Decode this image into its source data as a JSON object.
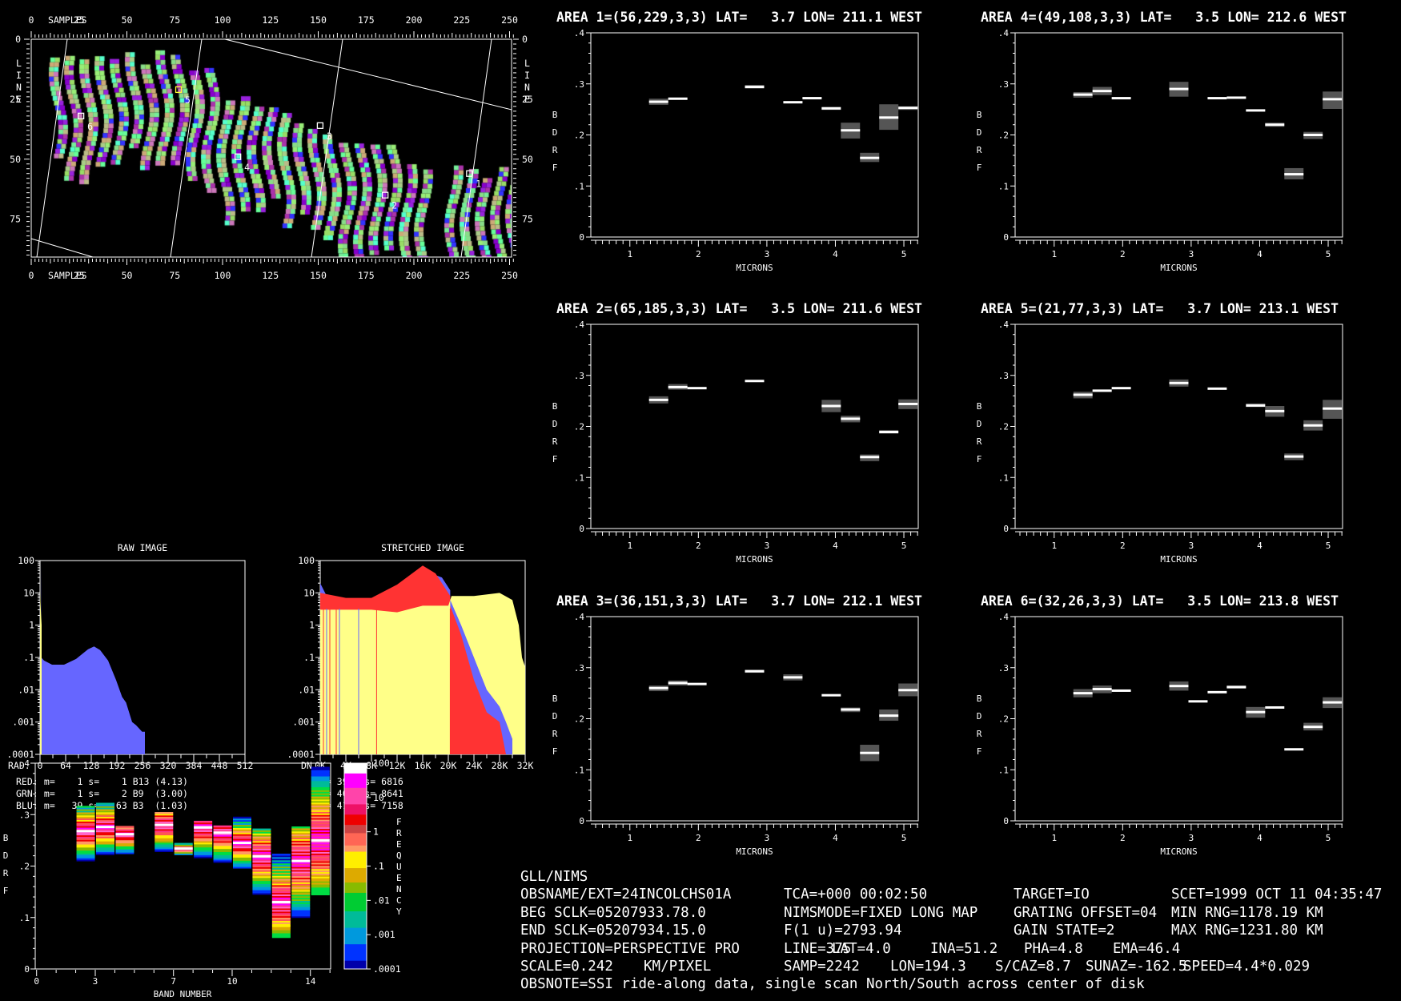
{
  "map": {
    "x_label": "SAMPLES",
    "y_label_letters": [
      "L",
      "I",
      "N",
      "E"
    ],
    "x_ticks": [
      0,
      25,
      50,
      75,
      100,
      125,
      150,
      175,
      200,
      225,
      250
    ],
    "y_ticks": [
      0,
      25,
      50,
      75
    ],
    "areas": [
      {
        "id": "1",
        "line": 56,
        "sample": 229,
        "color": "#ffffff"
      },
      {
        "id": "2",
        "line": 65,
        "sample": 185,
        "color": "#ffffff"
      },
      {
        "id": "3",
        "line": 36,
        "sample": 151,
        "color": "#ffffff"
      },
      {
        "id": "4",
        "line": 49,
        "sample": 108,
        "color": "#ffffff"
      },
      {
        "id": "5",
        "line": 21,
        "sample": 77,
        "color": "#ffff33"
      },
      {
        "id": "6",
        "line": 32,
        "sample": 26,
        "color": "#ffffff"
      }
    ]
  },
  "histograms": {
    "y_ticks": [
      "100",
      "10",
      "1",
      ".1",
      ".01",
      ".001",
      ".0001"
    ],
    "raw": {
      "title": "RAW IMAGE",
      "axis_label": "RAD.",
      "xlim": [
        0,
        512
      ],
      "x_ticks": [
        "0",
        "64",
        "128",
        "192",
        "256",
        "320",
        "384",
        "448",
        "512"
      ],
      "series": [
        {
          "name": "blue",
          "color": "#6666ff",
          "points": [
            [
              0,
              0.0001
            ],
            [
              2,
              0.0001
            ],
            [
              2,
              100
            ],
            [
              3,
              0.1
            ],
            [
              10,
              0.08
            ],
            [
              30,
              0.06
            ],
            [
              60,
              0.06
            ],
            [
              90,
              0.09
            ],
            [
              120,
              0.18
            ],
            [
              135,
              0.22
            ],
            [
              150,
              0.17
            ],
            [
              170,
              0.08
            ],
            [
              190,
              0.02
            ],
            [
              205,
              0.006
            ],
            [
              215,
              0.004
            ],
            [
              230,
              0.001
            ],
            [
              240,
              0.0008
            ],
            [
              255,
              0.0005
            ],
            [
              262,
              0.0005
            ],
            [
              262,
              0.0001
            ]
          ]
        },
        {
          "name": "yellow",
          "color": "#ffff88",
          "points": [
            [
              0,
              0.0001
            ],
            [
              0,
              10
            ],
            [
              2,
              3
            ],
            [
              4,
              1
            ],
            [
              4,
              0.0001
            ]
          ]
        }
      ]
    },
    "stretched": {
      "title": "STRETCHED IMAGE",
      "axis_label": "DN",
      "xlim": [
        0,
        32
      ],
      "x_ticks": [
        "0K",
        "4K",
        "8K",
        "12K",
        "16K",
        "20K",
        "24K",
        "28K",
        "32K"
      ],
      "series": [
        {
          "name": "blue-low",
          "color": "#6666ff",
          "points": [
            [
              0,
              0.0001
            ],
            [
              0,
              20
            ],
            [
              1,
              8
            ],
            [
              4,
              6
            ],
            [
              8,
              6
            ],
            [
              12,
              12
            ],
            [
              16,
              50
            ],
            [
              19,
              30
            ],
            [
              20.3,
              12
            ],
            [
              20.3,
              0.0001
            ]
          ]
        },
        {
          "name": "red-low",
          "color": "#ff3333",
          "points": [
            [
              0,
              0.0001
            ],
            [
              0,
              10
            ],
            [
              4,
              7
            ],
            [
              8,
              7
            ],
            [
              12,
              18
            ],
            [
              16,
              70
            ],
            [
              18,
              40
            ],
            [
              20.3,
              8
            ],
            [
              20.3,
              0.0001
            ]
          ]
        },
        {
          "name": "yellow",
          "color": "#ffff88",
          "points": [
            [
              0,
              0.0001
            ],
            [
              0,
              3
            ],
            [
              4,
              3
            ],
            [
              8,
              3
            ],
            [
              12,
              2.5
            ],
            [
              16,
              4
            ],
            [
              20,
              4
            ],
            [
              20.5,
              8
            ],
            [
              24,
              8
            ],
            [
              28,
              10
            ],
            [
              30,
              6
            ],
            [
              31,
              1
            ],
            [
              31.5,
              0.1
            ],
            [
              32,
              0.05
            ],
            [
              32,
              0.0001
            ]
          ]
        },
        {
          "name": "blue-high",
          "color": "#6666ff",
          "points": [
            [
              20.3,
              0.0001
            ],
            [
              20.3,
              6
            ],
            [
              22,
              1
            ],
            [
              24,
              0.1
            ],
            [
              26,
              0.01
            ],
            [
              28,
              0.003
            ],
            [
              29,
              0.001
            ],
            [
              30,
              0.0003
            ],
            [
              30,
              0.0001
            ]
          ]
        },
        {
          "name": "red-high",
          "color": "#ff3333",
          "points": [
            [
              20.3,
              0.0001
            ],
            [
              20.3,
              4
            ],
            [
              22,
              0.5
            ],
            [
              24,
              0.02
            ],
            [
              26,
              0.002
            ],
            [
              28,
              0.001
            ],
            [
              29,
              0.0001
            ]
          ]
        }
      ]
    },
    "stats": [
      {
        "label": "RED:",
        "text": " m=    1 s=    1 B13 (4.13)",
        "color": "#ff3333"
      },
      {
        "label": "GRN:",
        "text": " m=    1 s=    2 B9  (3.00)",
        "color": "#ffff88"
      },
      {
        "label": "BLU:",
        "text": " m=   39 s=   63 B3  (1.03)",
        "color": "#6666ff"
      }
    ],
    "stretched_stats": [
      "m= 3944 s= 6816",
      "m= 4026 s= 8641",
      "m= 4129 s= 7158"
    ]
  },
  "chart_data": [
    {
      "type": "bar",
      "title": "AREA 1=(56,229,3,3) LAT=   3.7 LON= 211.1 WEST",
      "xlabel": "MICRONS",
      "ylabel": "BDRF",
      "xlim": [
        0.43,
        5.21
      ],
      "ylim": [
        0,
        0.4
      ],
      "x_ticks": [
        "1",
        "2",
        "3",
        "4",
        "5"
      ],
      "y_ticks": [
        "0",
        ".1",
        ".2",
        ".3",
        ".4"
      ],
      "bands": [
        [
          0,
          0.265,
          0.259,
          0.271
        ],
        [
          1,
          0.271,
          0.269,
          0.273
        ],
        [
          5,
          0.294,
          0.291,
          0.298
        ],
        [
          7,
          0.264,
          0.263,
          0.266
        ],
        [
          8,
          0.272,
          0.271,
          0.274
        ],
        [
          9,
          0.252,
          0.249,
          0.255
        ],
        [
          10,
          0.209,
          0.193,
          0.224
        ],
        [
          11,
          0.155,
          0.147,
          0.165
        ],
        [
          12,
          0.234,
          0.21,
          0.26
        ],
        [
          13,
          0.253,
          0.249,
          0.256
        ]
      ]
    },
    {
      "type": "bar",
      "title": "AREA 4=(49,108,3,3) LAT=   3.5 LON= 212.6 WEST",
      "xlabel": "MICRONS",
      "ylabel": "BDRF",
      "xlim": [
        0.43,
        5.21
      ],
      "ylim": [
        0,
        0.4
      ],
      "x_ticks": [
        "1",
        "2",
        "3",
        "4",
        "5"
      ],
      "y_ticks": [
        "0",
        ".1",
        ".2",
        ".3",
        ".4"
      ],
      "bands": [
        [
          0,
          0.279,
          0.273,
          0.284
        ],
        [
          1,
          0.286,
          0.278,
          0.294
        ],
        [
          2,
          0.272,
          0.271,
          0.273
        ],
        [
          5,
          0.29,
          0.275,
          0.304
        ],
        [
          7,
          0.272,
          0.271,
          0.273
        ],
        [
          8,
          0.273,
          0.272,
          0.275
        ],
        [
          9,
          0.248,
          0.246,
          0.25
        ],
        [
          10,
          0.22,
          0.216,
          0.224
        ],
        [
          11,
          0.123,
          0.113,
          0.135
        ],
        [
          12,
          0.2,
          0.192,
          0.206
        ],
        [
          13,
          0.27,
          0.251,
          0.285
        ]
      ]
    },
    {
      "type": "bar",
      "title": "AREA 2=(65,185,3,3) LAT=   3.5 LON= 211.6 WEST",
      "xlabel": "MICRONS",
      "ylabel": "BDRF",
      "xlim": [
        0.43,
        5.21
      ],
      "ylim": [
        0,
        0.4
      ],
      "x_ticks": [
        "1",
        "2",
        "3",
        "4",
        "5"
      ],
      "y_ticks": [
        "0",
        ".1",
        ".2",
        ".3",
        ".4"
      ],
      "bands": [
        [
          0,
          0.252,
          0.245,
          0.259
        ],
        [
          1,
          0.277,
          0.272,
          0.283
        ],
        [
          2,
          0.275,
          0.274,
          0.276
        ],
        [
          5,
          0.289,
          0.288,
          0.29
        ],
        [
          9,
          0.24,
          0.228,
          0.252
        ],
        [
          10,
          0.215,
          0.208,
          0.221
        ],
        [
          11,
          0.14,
          0.132,
          0.145
        ],
        [
          12,
          0.189,
          0.186,
          0.193
        ],
        [
          13,
          0.244,
          0.234,
          0.253
        ]
      ]
    },
    {
      "type": "bar",
      "title": "AREA 5=(21,77,3,3) LAT=   3.7 LON= 213.1 WEST",
      "xlabel": "MICRONS",
      "ylabel": "BDRF",
      "xlim": [
        0.43,
        5.21
      ],
      "ylim": [
        0,
        0.4
      ],
      "x_ticks": [
        "1",
        "2",
        "3",
        "4",
        "5"
      ],
      "y_ticks": [
        "0",
        ".1",
        ".2",
        ".3",
        ".4"
      ],
      "bands": [
        [
          0,
          0.262,
          0.255,
          0.268
        ],
        [
          1,
          0.27,
          0.268,
          0.272
        ],
        [
          2,
          0.275,
          0.274,
          0.276
        ],
        [
          5,
          0.285,
          0.278,
          0.292
        ],
        [
          7,
          0.274,
          0.273,
          0.275
        ],
        [
          9,
          0.241,
          0.238,
          0.245
        ],
        [
          10,
          0.23,
          0.219,
          0.24
        ],
        [
          11,
          0.141,
          0.134,
          0.147
        ],
        [
          12,
          0.202,
          0.192,
          0.212
        ],
        [
          13,
          0.235,
          0.215,
          0.252
        ]
      ]
    },
    {
      "type": "bar",
      "title": "AREA 3=(36,151,3,3) LAT=   3.7 LON= 212.1 WEST",
      "xlabel": "MICRONS",
      "ylabel": "BDRF",
      "xlim": [
        0.43,
        5.21
      ],
      "ylim": [
        0,
        0.4
      ],
      "x_ticks": [
        "1",
        "2",
        "3",
        "4",
        "5"
      ],
      "y_ticks": [
        "0",
        ".1",
        ".2",
        ".3",
        ".4"
      ],
      "bands": [
        [
          0,
          0.26,
          0.254,
          0.265
        ],
        [
          1,
          0.27,
          0.265,
          0.275
        ],
        [
          2,
          0.268,
          0.267,
          0.269
        ],
        [
          5,
          0.293,
          0.29,
          0.296
        ],
        [
          7,
          0.281,
          0.275,
          0.287
        ],
        [
          9,
          0.246,
          0.245,
          0.247
        ],
        [
          10,
          0.218,
          0.213,
          0.222
        ],
        [
          11,
          0.133,
          0.117,
          0.149
        ],
        [
          12,
          0.206,
          0.196,
          0.218
        ],
        [
          13,
          0.256,
          0.244,
          0.269
        ]
      ]
    },
    {
      "type": "bar",
      "title": "AREA 6=(32,26,3,3) LAT=   3.5 LON= 213.8 WEST",
      "xlabel": "MICRONS",
      "ylabel": "BDRF",
      "xlim": [
        0.43,
        5.21
      ],
      "ylim": [
        0,
        0.4
      ],
      "x_ticks": [
        "1",
        "2",
        "3",
        "4",
        "5"
      ],
      "y_ticks": [
        "0",
        ".1",
        ".2",
        ".3",
        ".4"
      ],
      "bands": [
        [
          0,
          0.25,
          0.242,
          0.258
        ],
        [
          1,
          0.258,
          0.25,
          0.265
        ],
        [
          2,
          0.255,
          0.254,
          0.256
        ],
        [
          5,
          0.264,
          0.255,
          0.273
        ],
        [
          6,
          0.234,
          0.233,
          0.235
        ],
        [
          7,
          0.252,
          0.251,
          0.253
        ],
        [
          8,
          0.262,
          0.259,
          0.265
        ],
        [
          9,
          0.213,
          0.202,
          0.223
        ],
        [
          10,
          0.222,
          0.221,
          0.223
        ],
        [
          11,
          0.14,
          0.139,
          0.141
        ],
        [
          12,
          0.184,
          0.177,
          0.192
        ],
        [
          13,
          0.232,
          0.221,
          0.242
        ]
      ]
    },
    {
      "type": "heatmap",
      "title": "",
      "xlabel": "BAND NUMBER",
      "ylabel": "BDRF",
      "xlim": [
        0,
        15.1
      ],
      "ylim": [
        0,
        0.4
      ],
      "x_ticks": [
        "0",
        "3",
        "7",
        "10",
        "14"
      ],
      "x_tick_values": [
        0,
        3,
        7,
        10,
        14
      ],
      "y_ticks": [
        "0",
        ".1",
        ".2",
        ".3",
        ".4"
      ],
      "colorbar": {
        "label": "FREQUENCY",
        "ticks": [
          "100",
          "10",
          "1",
          ".1",
          ".01",
          ".001",
          ".0001"
        ]
      },
      "columns": [
        [
          2,
          0.21,
          0.317,
          0.268
        ],
        [
          3,
          0.222,
          0.323,
          0.276
        ],
        [
          4,
          0.224,
          0.278,
          0.262
        ],
        [
          6,
          0.228,
          0.305,
          0.28
        ],
        [
          7,
          0.222,
          0.245,
          0.234
        ],
        [
          8,
          0.216,
          0.288,
          0.275
        ],
        [
          9,
          0.207,
          0.279,
          0.265
        ],
        [
          10,
          0.196,
          0.296,
          0.245
        ],
        [
          11,
          0.145,
          0.273,
          0.219
        ],
        [
          12,
          0.061,
          0.224,
          0.13
        ],
        [
          13,
          0.1,
          0.277,
          0.21
        ],
        [
          14,
          0.144,
          0.393,
          0.25
        ]
      ]
    }
  ],
  "info": {
    "rows": [
      [
        "GLL/NIMS"
      ],
      [
        "OBSNAME/EXT=24INCOLCHS01A",
        "TCA=+000 00:02:50",
        "TARGET=IO",
        "SCET=1999 OCT 11 04:35:47"
      ],
      [
        "BEG SCLK=05207933.78.0",
        "NIMSMODE=FIXED LONG MAP",
        "GRATING OFFSET=04",
        "MIN RNG=1178.19 KM"
      ],
      [
        "END SCLK=05207934.15.0",
        "F(1 u)=2793.94",
        "GAIN STATE=2",
        "MAX RNG=1231.80 KM"
      ],
      [
        "PROJECTION=PERSPECTIVE PRO",
        "LINE=375",
        "LAT=4.0",
        "INA=51.2",
        "PHA=4.8",
        "EMA=46.4"
      ],
      [
        "SCALE=0.242",
        "KM/PIXEL",
        "SAMP=2242",
        "LON=194.3",
        "S/CAZ=8.7",
        "SUNAZ=-162.5",
        "SPEED=4.4*0.029"
      ],
      [
        "OBSNOTE=SSI ride-along data, single scan North/South across center of disk"
      ]
    ]
  },
  "colors": {
    "background": "#000000",
    "axis": "#ffffff",
    "error_band": "#555555",
    "mean": "#ffffff"
  }
}
